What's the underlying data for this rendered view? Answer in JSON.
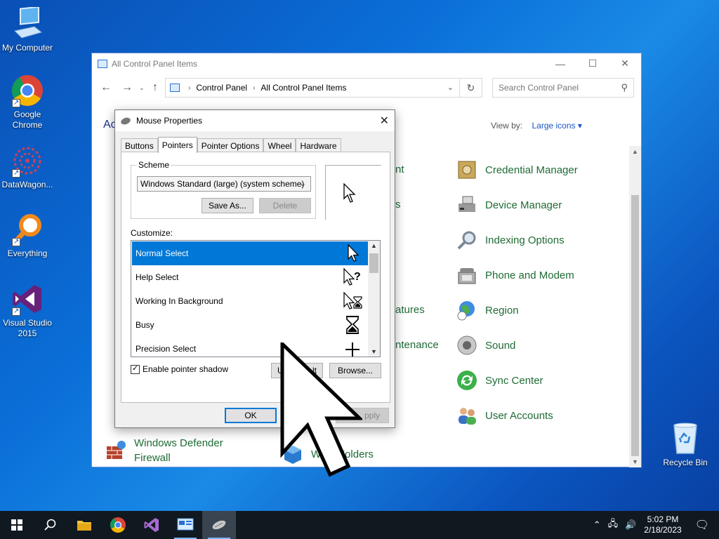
{
  "desktop": {
    "icons": [
      {
        "label": "My Computer"
      },
      {
        "label": "Google Chrome"
      },
      {
        "label": "DataWagon..."
      },
      {
        "label": "Everything"
      },
      {
        "label": "Visual Studio 2015"
      }
    ],
    "recycle_bin": "Recycle Bin"
  },
  "control_panel": {
    "title": "All Control Panel Items",
    "breadcrumb": [
      "Control Panel",
      "All Control Panel Items"
    ],
    "search_placeholder": "Search Control Panel",
    "heading_fragment": "Ac",
    "view_by_label": "View by:",
    "view_by_value": "Large icons",
    "items_right": [
      "Credential Manager",
      "Device Manager",
      "Indexing Options",
      "Phone and Modem",
      "Region",
      "Sound",
      "Sync Center",
      "User Accounts"
    ],
    "items_middle_partial": [
      "nt",
      "s",
      "atures",
      "ntenance"
    ],
    "item_bottom_left": [
      "Windows Defender",
      "Firewall"
    ],
    "item_bottom_middle": "Work Folders"
  },
  "mouse_dialog": {
    "title": "Mouse Properties",
    "tabs": [
      "Buttons",
      "Pointers",
      "Pointer Options",
      "Wheel",
      "Hardware"
    ],
    "active_tab": "Pointers",
    "scheme_legend": "Scheme",
    "scheme_value": "Windows Standard (large) (system scheme)",
    "save_as": "Save As...",
    "delete": "Delete",
    "customize_label": "Customize:",
    "cursors": [
      "Normal Select",
      "Help Select",
      "Working In Background",
      "Busy",
      "Precision Select"
    ],
    "selected_cursor": "Normal Select",
    "enable_shadow": "Enable pointer shadow",
    "use_default_partial": "U",
    "use_default_tail": "lt",
    "browse": "Browse...",
    "ok": "OK",
    "apply_partial": "pply"
  },
  "taskbar": {
    "time": "5:02 PM",
    "date": "2/18/2023"
  }
}
